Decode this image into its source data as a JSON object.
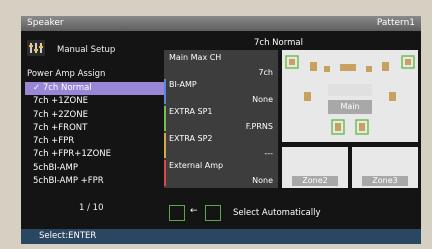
{
  "header": {
    "title": "Speaker",
    "pattern": "Pattern1"
  },
  "left": {
    "manual_setup": "Manual Setup",
    "power_amp_assign": "Power Amp Assign",
    "items": [
      {
        "label": "✓ 7ch Normal"
      },
      {
        "label": "7ch +1ZONE"
      },
      {
        "label": "7ch +2ZONE"
      },
      {
        "label": "7ch +FRONT"
      },
      {
        "label": "7ch +FPR"
      },
      {
        "label": "7ch +FPR+1ZONE"
      },
      {
        "label": "5chBI-AMP"
      },
      {
        "label": "5chBI-AMP +FPR"
      }
    ],
    "page": "1 / 10"
  },
  "middle": {
    "heading": "7ch Normal",
    "rows": [
      {
        "key": "Main Max CH",
        "value": "7ch",
        "color": "#3d3d3d"
      },
      {
        "key": "BI-AMP",
        "value": "None",
        "color": "#5b86d8"
      },
      {
        "key": "EXTRA SP1",
        "value": "F.PRNS",
        "color": "#6fc04e"
      },
      {
        "key": "EXTRA SP2",
        "value": "---",
        "color": "#d6a840"
      },
      {
        "key": "External Amp",
        "value": "None",
        "color": "#d84a4a"
      }
    ]
  },
  "diagram": {
    "main_label": "Main",
    "zone2": "Zone2",
    "zone3": "Zone3"
  },
  "select_auto": "Select Automatically",
  "footer": {
    "hint": "Select:ENTER"
  },
  "colors": {
    "selection": "#9a86d6",
    "footer": "#2a4660",
    "accent_green": "#55aa44"
  }
}
